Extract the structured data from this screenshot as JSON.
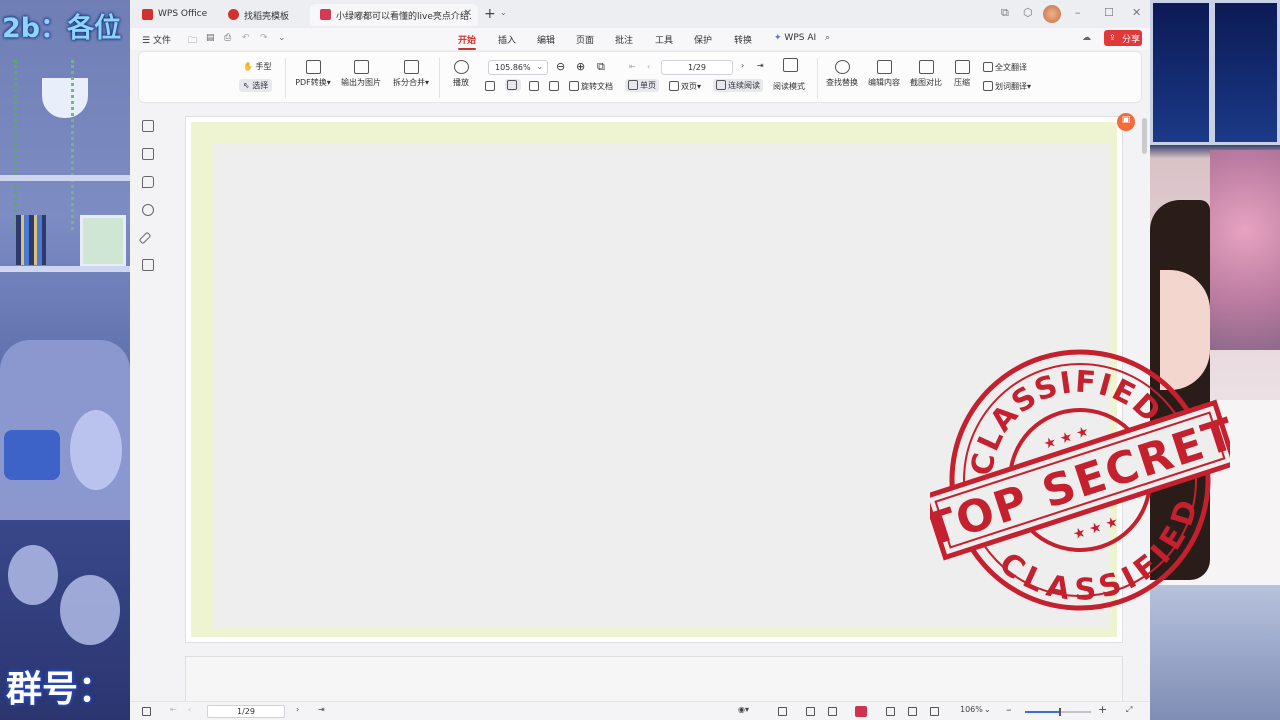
{
  "overlay": {
    "top_text": "2b：各位",
    "bottom_text": "群号："
  },
  "tabs": [
    {
      "label": "WPS Office",
      "icon": "wps-logo-icon",
      "color": "#d0322e"
    },
    {
      "label": "找稻壳模板",
      "icon": "docer-icon",
      "color": "#d0322e"
    },
    {
      "label": "小绿嘟都可以看懂的live亮点介绍.pdf",
      "display": "小绿嘟都可以看懂的live亮点介绍.",
      "icon": "pdf-icon",
      "color": "#d23b55",
      "active": true
    }
  ],
  "menubar": {
    "file": "文件",
    "items": [
      "开始",
      "插入",
      "编辑",
      "页面",
      "批注",
      "工具",
      "保护",
      "转换",
      "WPS AI"
    ],
    "active": "开始",
    "share": "分享"
  },
  "ribbon": {
    "hand": "手型",
    "select": "选择",
    "pdf_convert": "PDF转换",
    "export_image": "输出为图片",
    "split_merge": "拆分合并",
    "play": "播放",
    "zoom_value": "105.86%",
    "page_value": "1/29",
    "rotate": "旋转文档",
    "single_page": "单页",
    "double_page": "双页",
    "continuous": "连续阅读",
    "reading_mode": "阅读模式",
    "find_replace": "查找替换",
    "edit_content": "编辑内容",
    "screenshot_compare": "截图对比",
    "compress": "压缩",
    "full_translate": "全文翻译",
    "word_translate": "划词翻译"
  },
  "stamp": {
    "top_word": "CLASSIFIED",
    "bottom_word": "CLASSIFIED",
    "band": "TOP SECRET",
    "color": "#c4202e"
  },
  "statusbar": {
    "page_value": "1/29",
    "zoom": "106%"
  },
  "colors": {
    "accent": "#d0322e",
    "page_border": "#eef3d2"
  }
}
